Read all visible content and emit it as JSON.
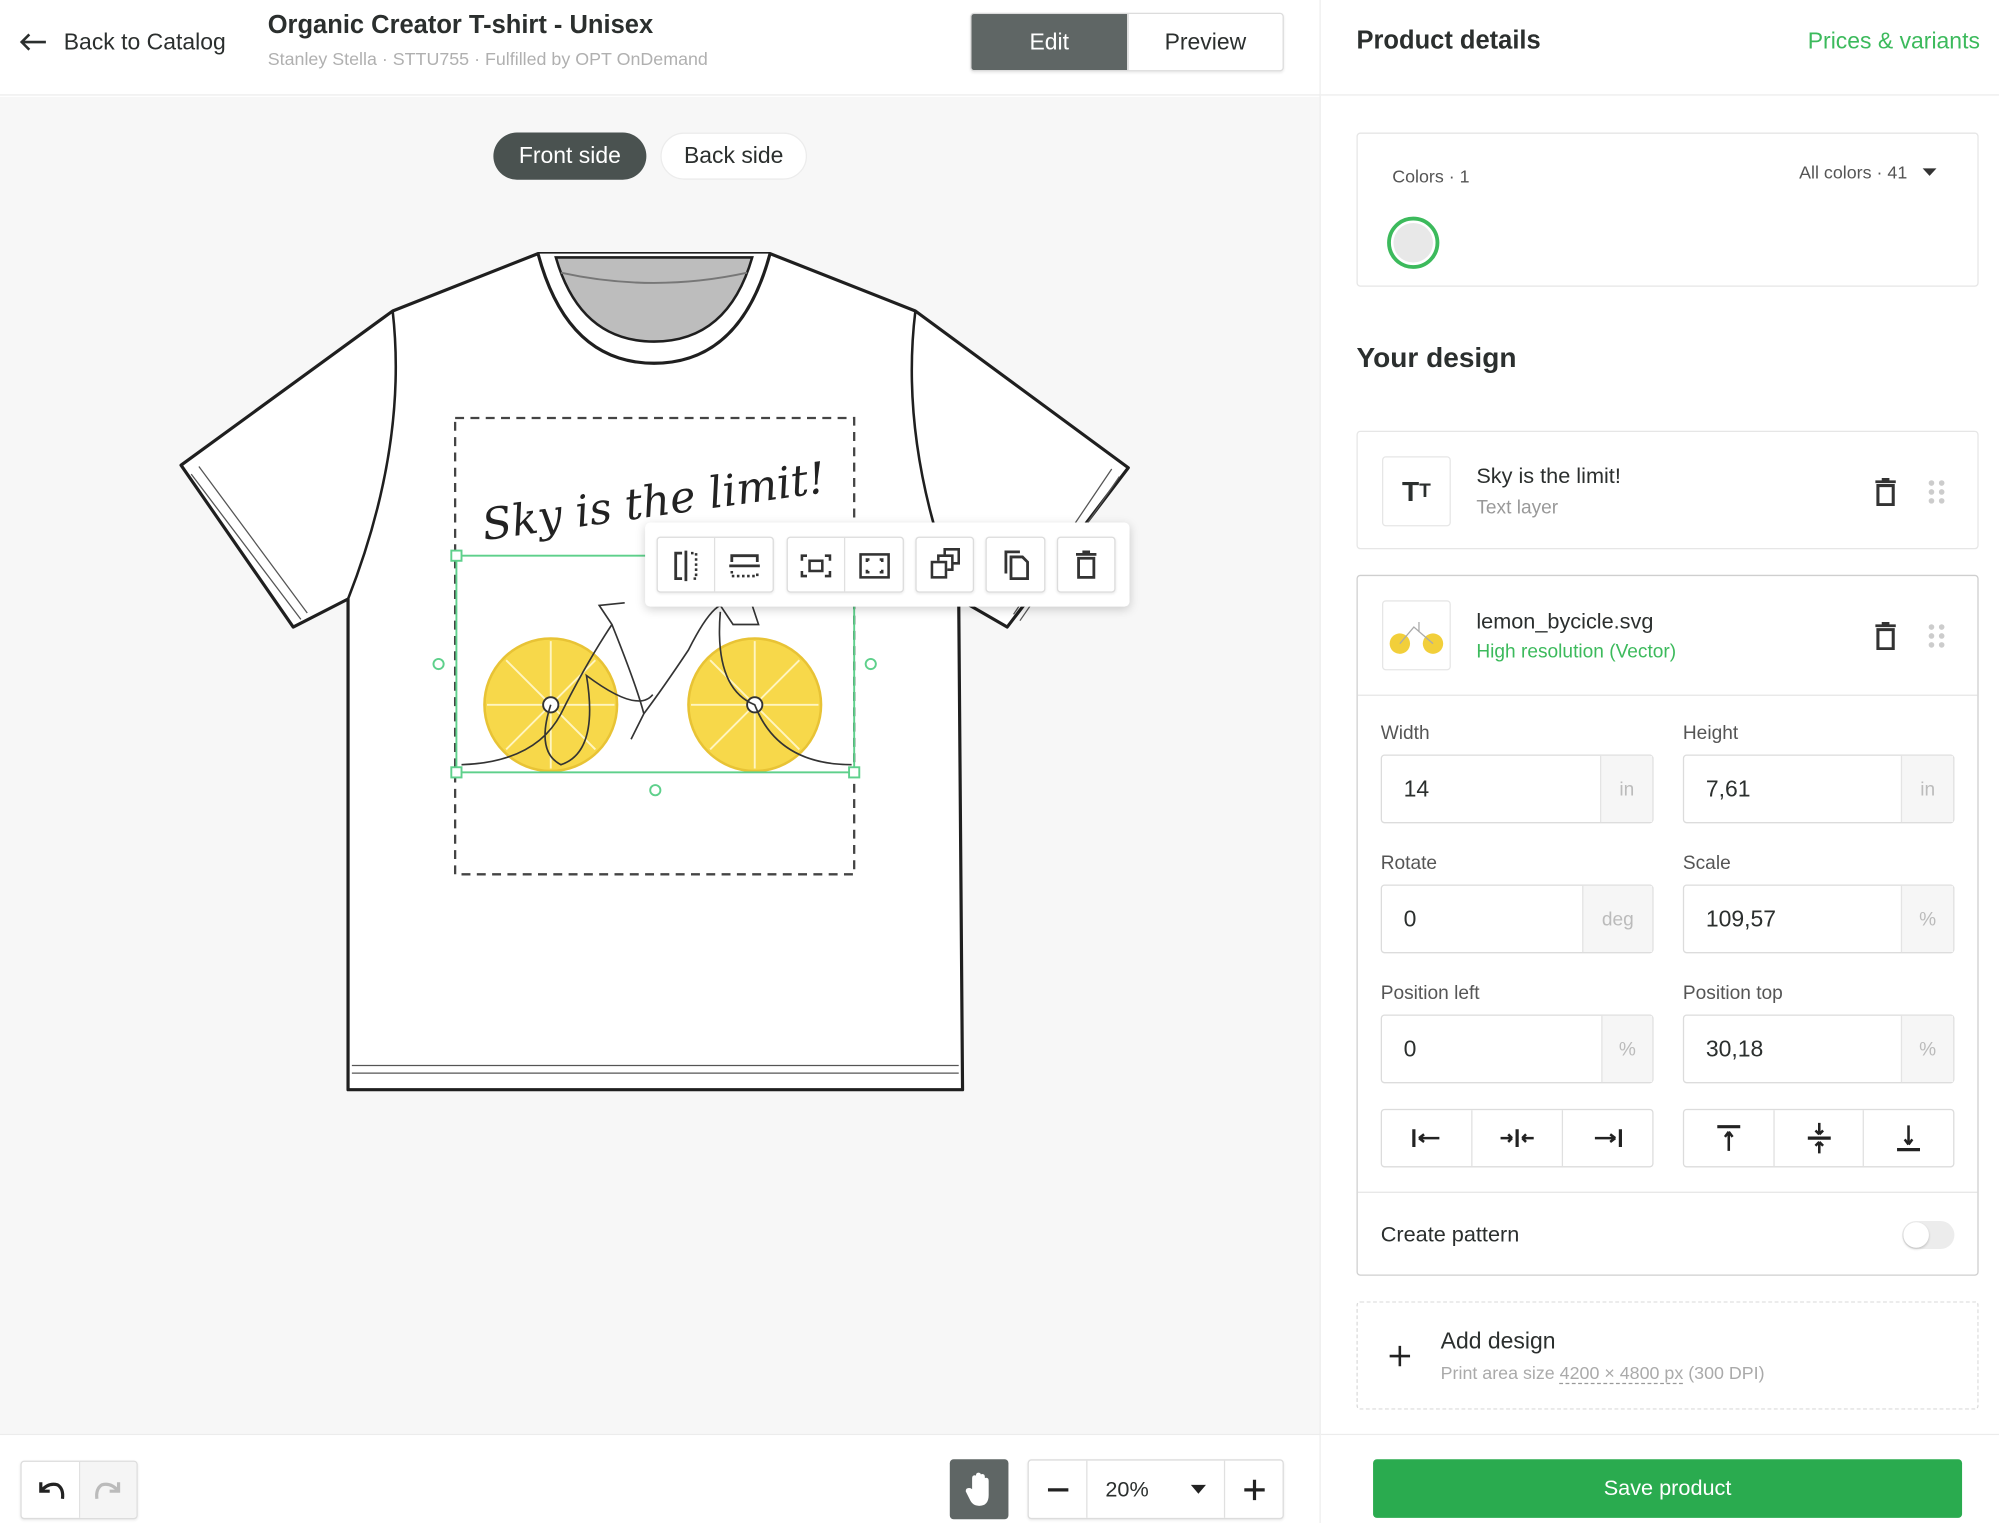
{
  "header": {
    "back_label": "Back to Catalog",
    "title": "Organic Creator T-shirt - Unisex",
    "subtitle": "Stanley Stella · STTU755 · Fulfilled by OPT OnDemand",
    "mode_tabs": [
      {
        "label": "Edit",
        "active": true
      },
      {
        "label": "Preview",
        "active": false
      }
    ]
  },
  "canvas": {
    "side_tabs": [
      {
        "label": "Front side",
        "active": true
      },
      {
        "label": "Back side",
        "active": false
      }
    ],
    "design_text": "Sky is the limit!",
    "toolbar_icons": [
      "flip-horizontal-icon",
      "flip-vertical-icon",
      "fit-to-area-icon",
      "fill-area-icon",
      "duplicate-icon",
      "copy-icon",
      "trash-icon"
    ]
  },
  "bottom_bar": {
    "zoom_value": "20%",
    "icons": [
      "undo-icon",
      "redo-icon",
      "hand-icon",
      "minus-icon",
      "caret-down-icon",
      "plus-icon"
    ]
  },
  "panel": {
    "title": "Product details",
    "prices_link": "Prices & variants",
    "colors_label": "Colors · 1",
    "all_colors_label": "All colors · 41",
    "selected_color": "#e8e8e8",
    "your_design_title": "Your design",
    "layers": [
      {
        "name": "Sky is the limit!",
        "subtitle": "Text layer",
        "icon": "text-icon"
      },
      {
        "name": "lemon_bycicle.svg",
        "subtitle": "High resolution (Vector)",
        "icon": "image-thumbnail"
      }
    ],
    "fields": {
      "width": {
        "label": "Width",
        "value": "14",
        "unit": "in"
      },
      "height": {
        "label": "Height",
        "value": "7,61",
        "unit": "in"
      },
      "rotate": {
        "label": "Rotate",
        "value": "0",
        "unit": "deg"
      },
      "scale": {
        "label": "Scale",
        "value": "109,57",
        "unit": "%"
      },
      "position_left": {
        "label": "Position left",
        "value": "0",
        "unit": "%"
      },
      "position_top": {
        "label": "Position top",
        "value": "30,18",
        "unit": "%"
      }
    },
    "align_icons": [
      "align-left-icon",
      "align-center-horizontal-icon",
      "align-right-icon",
      "align-top-icon",
      "align-middle-vertical-icon",
      "align-bottom-icon"
    ],
    "create_pattern_label": "Create pattern",
    "create_pattern_on": false,
    "add_design_label": "Add design",
    "print_area_prefix": "Print area size",
    "print_area_size": "4200 × 4800 px",
    "print_area_dpi": "(300 DPI)",
    "save_label": "Save product"
  },
  "colors": {
    "accent": "#3cba5c",
    "save": "#2aab4f",
    "dark": "#5f6665",
    "lemon": "#f7d84a"
  }
}
